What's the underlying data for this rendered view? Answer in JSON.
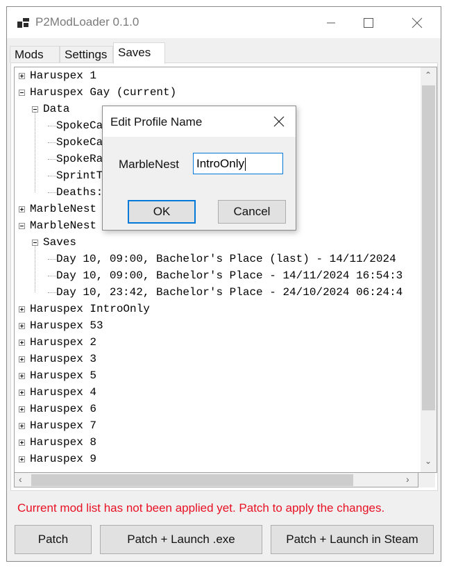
{
  "window": {
    "title": "P2ModLoader 0.1.0",
    "icon": "app-icon",
    "controls": [
      "minimize-icon",
      "maximize-icon",
      "close-icon"
    ]
  },
  "tabs": [
    {
      "label": "Mods",
      "active": false
    },
    {
      "label": "Settings",
      "active": false
    },
    {
      "label": "Saves",
      "active": true
    }
  ],
  "tree": {
    "nodes": [
      {
        "label": "Haruspex 1",
        "level": 0,
        "expander": "plus"
      },
      {
        "label": "Haruspex Gay (current)",
        "level": 0,
        "expander": "minus"
      },
      {
        "label": "Data",
        "level": 1,
        "expander": "minus"
      },
      {
        "label": "SpokeCa",
        "level": 2,
        "expander": "none"
      },
      {
        "label": "SpokeCa",
        "level": 2,
        "expander": "none"
      },
      {
        "label": "SpokeRa",
        "level": 2,
        "expander": "none"
      },
      {
        "label": "SprintT",
        "level": 2,
        "expander": "none"
      },
      {
        "label": "Deaths:",
        "level": 2,
        "expander": "none"
      },
      {
        "label": "MarbleNest",
        "level": 0,
        "expander": "plus"
      },
      {
        "label": "MarbleNest",
        "level": 0,
        "expander": "minus"
      },
      {
        "label": "Saves",
        "level": 1,
        "expander": "minus"
      },
      {
        "label": "Day 10, 09:00, Bachelor's Place (last) - 14/11/2024",
        "level": 2,
        "expander": "none"
      },
      {
        "label": "Day 10, 09:00, Bachelor's Place - 14/11/2024 16:54:3",
        "level": 2,
        "expander": "none"
      },
      {
        "label": "Day 10, 23:42, Bachelor's Place - 24/10/2024 06:24:4",
        "level": 2,
        "expander": "none"
      },
      {
        "label": "Haruspex IntroOnly",
        "level": 0,
        "expander": "plus"
      },
      {
        "label": "Haruspex 53",
        "level": 0,
        "expander": "plus"
      },
      {
        "label": "Haruspex 2",
        "level": 0,
        "expander": "plus"
      },
      {
        "label": "Haruspex 3",
        "level": 0,
        "expander": "plus"
      },
      {
        "label": "Haruspex 5",
        "level": 0,
        "expander": "plus"
      },
      {
        "label": "Haruspex 4",
        "level": 0,
        "expander": "plus"
      },
      {
        "label": "Haruspex 6",
        "level": 0,
        "expander": "plus"
      },
      {
        "label": "Haruspex 7",
        "level": 0,
        "expander": "plus"
      },
      {
        "label": "Haruspex 8",
        "level": 0,
        "expander": "plus"
      },
      {
        "label": "Haruspex 9",
        "level": 0,
        "expander": "plus"
      }
    ]
  },
  "status": {
    "warning": "Current mod list has not been applied yet. Patch to apply the changes.",
    "warning_color": "#e81123"
  },
  "buttons": {
    "patch": "Patch",
    "patch_launch_exe": "Patch + Launch .exe",
    "patch_launch_steam": "Patch + Launch in Steam"
  },
  "dialog": {
    "title": "Edit Profile Name",
    "label": "MarbleNest",
    "input_value": "IntroOnly",
    "ok": "OK",
    "cancel": "Cancel",
    "accent": "#0078d7"
  }
}
